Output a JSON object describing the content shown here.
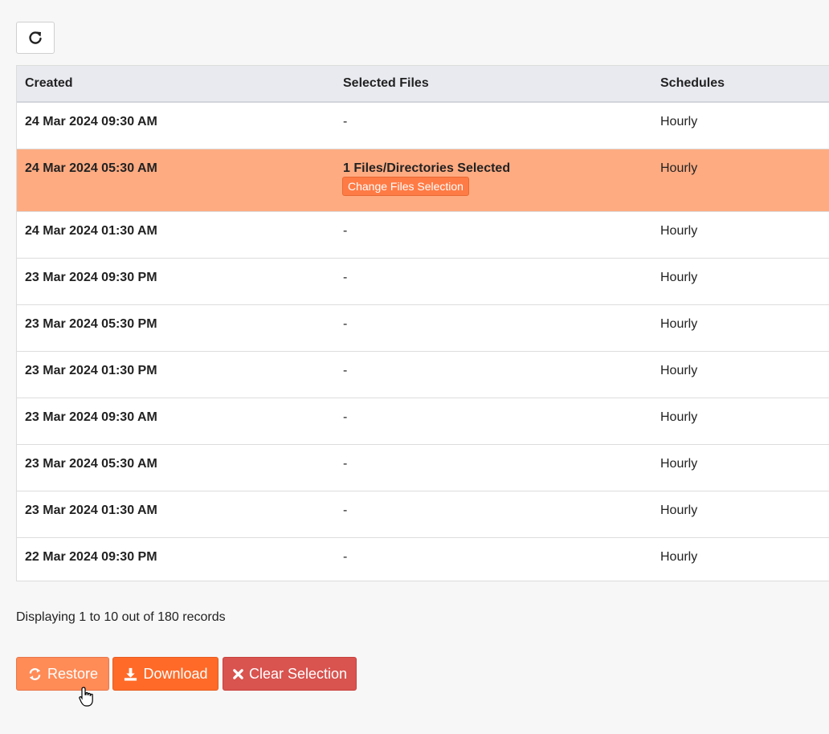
{
  "table": {
    "headers": {
      "created": "Created",
      "files": "Selected Files",
      "schedules": "Schedules"
    },
    "rows": [
      {
        "created": "24 Mar 2024 09:30 AM",
        "files": "-",
        "schedule": "Hourly"
      },
      {
        "created": "24 Mar 2024 05:30 AM",
        "files": "1 Files/Directories Selected",
        "schedule": "Hourly",
        "change_label": "Change Files Selection",
        "selected": true
      },
      {
        "created": "24 Mar 2024 01:30 AM",
        "files": "-",
        "schedule": "Hourly"
      },
      {
        "created": "23 Mar 2024 09:30 PM",
        "files": "-",
        "schedule": "Hourly"
      },
      {
        "created": "23 Mar 2024 05:30 PM",
        "files": "-",
        "schedule": "Hourly"
      },
      {
        "created": "23 Mar 2024 01:30 PM",
        "files": "-",
        "schedule": "Hourly"
      },
      {
        "created": "23 Mar 2024 09:30 AM",
        "files": "-",
        "schedule": "Hourly"
      },
      {
        "created": "23 Mar 2024 05:30 AM",
        "files": "-",
        "schedule": "Hourly"
      },
      {
        "created": "23 Mar 2024 01:30 AM",
        "files": "-",
        "schedule": "Hourly"
      },
      {
        "created": "22 Mar 2024 09:30 PM",
        "files": "-",
        "schedule": "Hourly"
      }
    ]
  },
  "pagination": {
    "text": "Displaying 1 to 10 out of 180 records"
  },
  "actions": {
    "restore": "Restore",
    "download": "Download",
    "clear": "Clear Selection"
  },
  "colors": {
    "selected_row": "#ffab82",
    "restore": "#ff8b57",
    "download": "#ff6a28",
    "clear": "#d9534f",
    "header_bg": "#e8eaf0"
  },
  "icons": {
    "refresh": "refresh-icon",
    "restore": "sync-icon",
    "download": "download-icon",
    "clear": "close-icon"
  }
}
